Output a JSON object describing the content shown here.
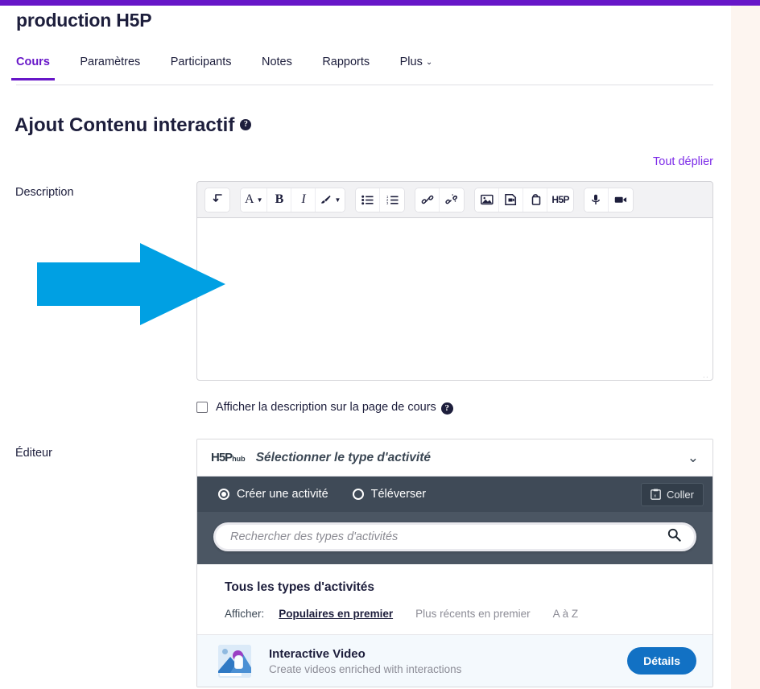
{
  "theme": {
    "brand_purple": "#6716c8",
    "link_purple": "#7c2ae8",
    "hub_dark": "#3f4a57",
    "hub_search_bg": "#4b5663",
    "details_blue": "#1271c4",
    "arrow_blue": "#00a0e3",
    "text_dark": "#1d1e3c"
  },
  "header": {
    "course_title": "production H5P",
    "tabs": [
      {
        "label": "Cours",
        "active": true,
        "has_caret": false
      },
      {
        "label": "Paramètres",
        "active": false,
        "has_caret": false
      },
      {
        "label": "Participants",
        "active": false,
        "has_caret": false
      },
      {
        "label": "Notes",
        "active": false,
        "has_caret": false
      },
      {
        "label": "Rapports",
        "active": false,
        "has_caret": false
      },
      {
        "label": "Plus",
        "active": false,
        "has_caret": true,
        "caret": "⌄"
      }
    ]
  },
  "page": {
    "heading": "Ajout Contenu interactif",
    "heading_help_glyph": "?",
    "expand_all_label": "Tout déplier"
  },
  "form": {
    "description_label": "Description",
    "editor_label": "Éditeur",
    "description_value": "",
    "show_description_checkbox": {
      "label": "Afficher la description sur la page de cours",
      "checked": false,
      "help_glyph": "?"
    }
  },
  "editor_toolbar": {
    "groups": [
      {
        "buttons": [
          {
            "name": "paragraph-style-icon",
            "glyph": "↲",
            "dropdown": false
          }
        ]
      },
      {
        "buttons": [
          {
            "name": "font-family-icon",
            "glyph": "A",
            "dropdown": true,
            "style": "serif"
          },
          {
            "name": "bold-icon",
            "glyph": "B",
            "dropdown": false,
            "style": "bold"
          },
          {
            "name": "italic-icon",
            "glyph": "I",
            "dropdown": false,
            "style": "italic"
          },
          {
            "name": "highlight-brush-icon",
            "glyph": "🖌",
            "dropdown": true
          }
        ]
      },
      {
        "buttons": [
          {
            "name": "bulleted-list-icon",
            "glyph": "☰",
            "dropdown": false
          },
          {
            "name": "numbered-list-icon",
            "glyph": "☰",
            "dropdown": false
          }
        ]
      },
      {
        "buttons": [
          {
            "name": "insert-link-icon",
            "glyph": "🔗",
            "dropdown": false
          },
          {
            "name": "unlink-icon",
            "glyph": "🔗",
            "dropdown": false
          }
        ]
      },
      {
        "buttons": [
          {
            "name": "insert-image-icon",
            "glyph": "🖼",
            "dropdown": false
          },
          {
            "name": "insert-media-icon",
            "glyph": "🎞",
            "dropdown": false
          },
          {
            "name": "manage-files-icon",
            "glyph": "🗐",
            "dropdown": false
          },
          {
            "name": "insert-h5p-icon",
            "glyph": "H5P",
            "dropdown": false,
            "style": "h5p"
          }
        ]
      },
      {
        "buttons": [
          {
            "name": "record-audio-icon",
            "glyph": "🎤",
            "dropdown": false
          },
          {
            "name": "record-video-icon",
            "glyph": "🎥",
            "dropdown": false
          }
        ]
      }
    ]
  },
  "hub": {
    "logo_main": "H5P",
    "logo_sub": "hub",
    "header_title": "Sélectionner le type d'activité",
    "collapse_chevron": "⌄",
    "modes": [
      {
        "label": "Créer une activité",
        "selected": true
      },
      {
        "label": "Téléverser",
        "selected": false
      }
    ],
    "paste_button": "Coller",
    "paste_icon": "clipboard-icon",
    "search_placeholder": "Rechercher des types d'activités",
    "search_value": "",
    "body_title": "Tous les types d'activités",
    "filter_label": "Afficher:",
    "filter_options": [
      {
        "label": "Populaires en premier",
        "active": true
      },
      {
        "label": "Plus récents en premier",
        "active": false
      },
      {
        "label": "A à Z",
        "active": false
      }
    ],
    "activities": [
      {
        "title": "Interactive Video",
        "description": "Create videos enriched with interactions",
        "details_label": "Détails",
        "thumb": "interactive-video-thumbnail"
      }
    ]
  },
  "annotation": {
    "arrow": {
      "name": "blue-pointer-arrow",
      "direction": "right",
      "color": "#00a0e3"
    }
  }
}
